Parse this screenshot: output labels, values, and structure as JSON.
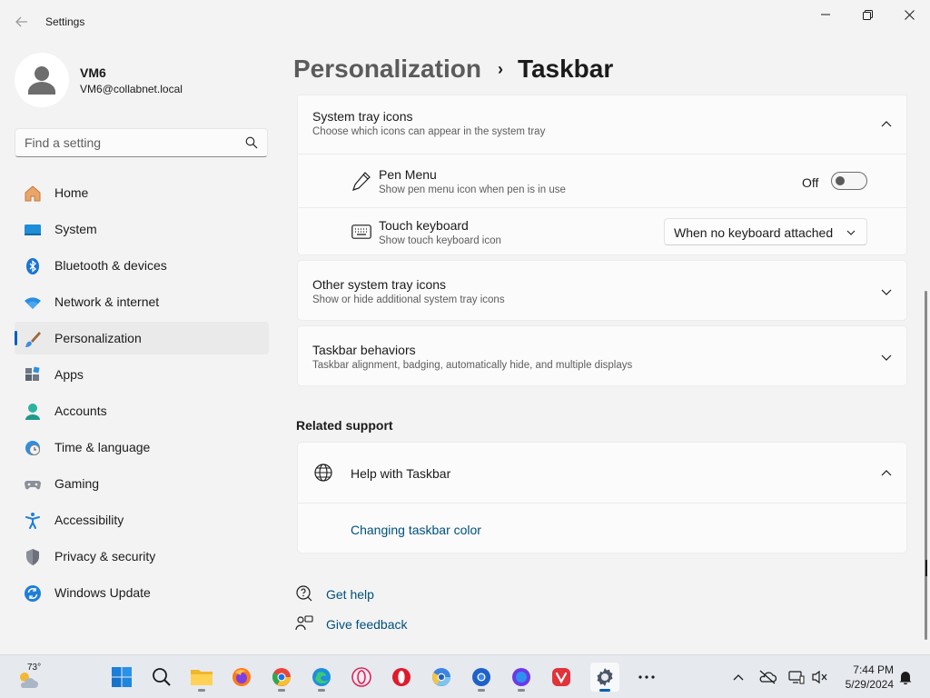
{
  "window": {
    "title": "Settings"
  },
  "profile": {
    "name": "VM6",
    "email": "VM6@collabnet.local"
  },
  "search": {
    "placeholder": "Find a setting"
  },
  "sidebar": {
    "items": [
      {
        "label": "Home",
        "icon": "home-icon"
      },
      {
        "label": "System",
        "icon": "system-icon"
      },
      {
        "label": "Bluetooth & devices",
        "icon": "bluetooth-icon"
      },
      {
        "label": "Network & internet",
        "icon": "wifi-icon"
      },
      {
        "label": "Personalization",
        "icon": "brush-icon",
        "active": true
      },
      {
        "label": "Apps",
        "icon": "apps-icon"
      },
      {
        "label": "Accounts",
        "icon": "accounts-icon"
      },
      {
        "label": "Time & language",
        "icon": "clock-globe-icon"
      },
      {
        "label": "Gaming",
        "icon": "gamepad-icon"
      },
      {
        "label": "Accessibility",
        "icon": "accessibility-icon"
      },
      {
        "label": "Privacy & security",
        "icon": "shield-icon"
      },
      {
        "label": "Windows Update",
        "icon": "update-icon"
      }
    ]
  },
  "header": {
    "parent": "Personalization",
    "separator": "›",
    "current": "Taskbar"
  },
  "system_tray": {
    "title": "System tray icons",
    "subtitle": "Choose which icons can appear in the system tray",
    "pen_menu": {
      "title": "Pen Menu",
      "subtitle": "Show pen menu icon when pen is in use",
      "state_label": "Off"
    },
    "touch_keyboard": {
      "title": "Touch keyboard",
      "subtitle": "Show touch keyboard icon",
      "selected": "When no keyboard attached"
    }
  },
  "other_tray": {
    "title": "Other system tray icons",
    "subtitle": "Show or hide additional system tray icons"
  },
  "behaviors": {
    "title": "Taskbar behaviors",
    "subtitle": "Taskbar alignment, badging, automatically hide, and multiple displays"
  },
  "related": {
    "title": "Related support",
    "help_title": "Help with Taskbar",
    "help_link": "Changing taskbar color"
  },
  "footer_links": {
    "get_help": "Get help",
    "give_feedback": "Give feedback"
  },
  "taskbar": {
    "weather_temp": "73°",
    "time": "7:44 PM",
    "date": "5/29/2024",
    "apps": [
      "start-icon",
      "search-icon",
      "file-explorer-icon",
      "firefox-icon",
      "chrome-icon",
      "edge-icon",
      "opera-gx-icon",
      "opera-icon",
      "chrome-beta-icon",
      "chrome-dev-icon",
      "chromium-icon",
      "vivaldi-icon",
      "settings-icon",
      "more-icon"
    ]
  },
  "colors": {
    "accent": "#005fb8",
    "link": "#00507a",
    "background": "#f3f3f3",
    "card": "#fbfbfb"
  }
}
